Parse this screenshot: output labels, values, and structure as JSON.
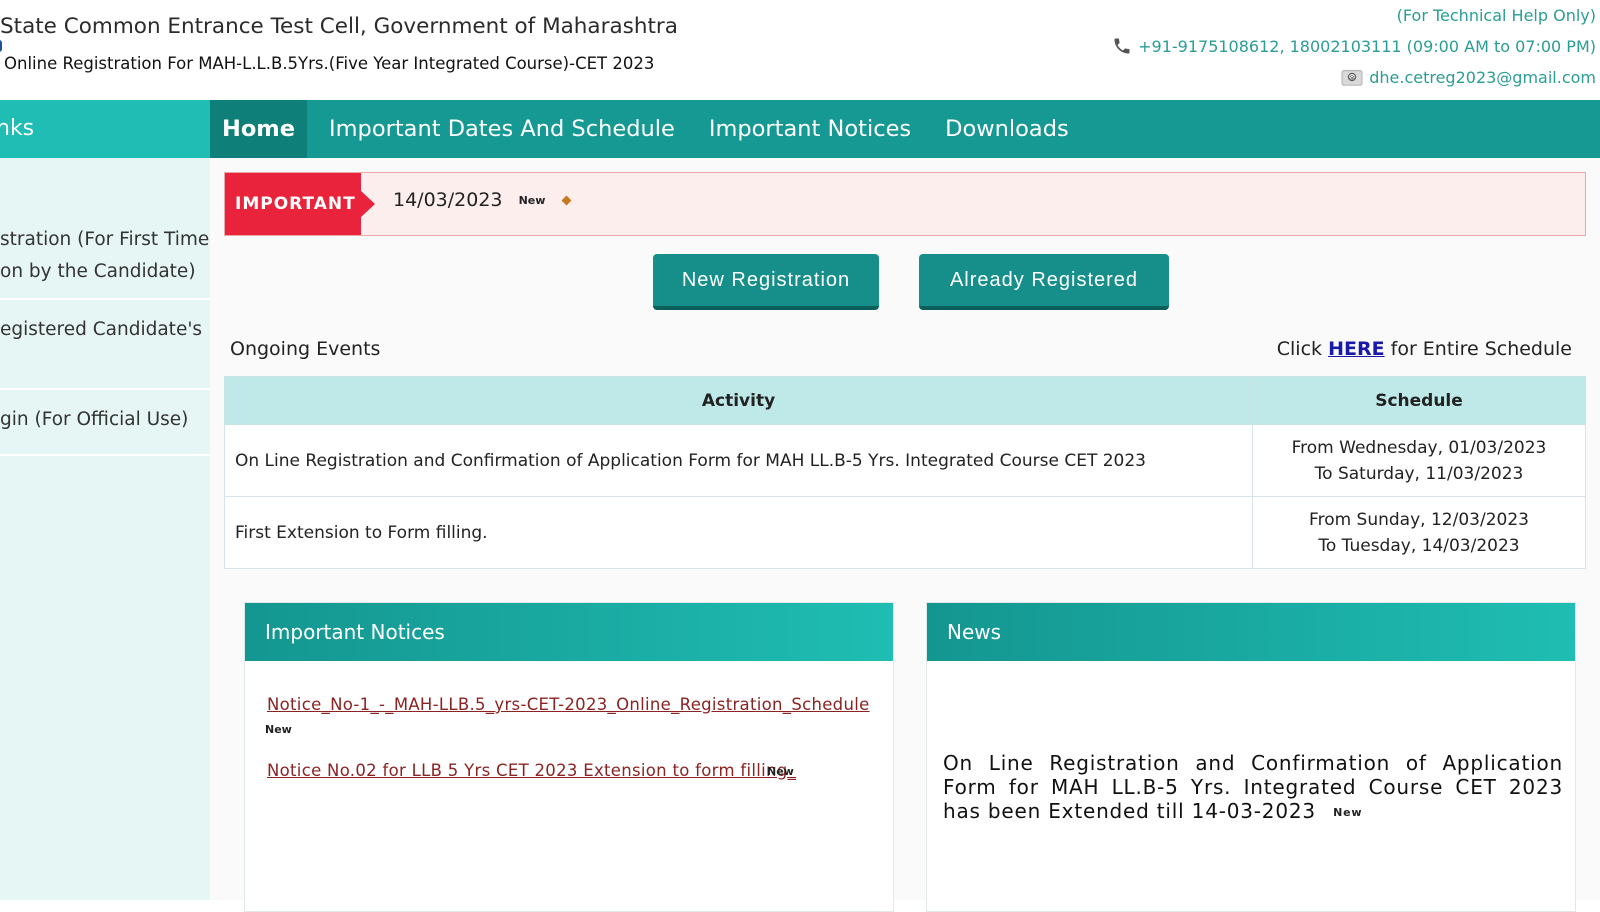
{
  "header": {
    "title": "State Common Entrance Test Cell, Government of Maharashtra",
    "subtitle": "Online Registration For MAH-L.L.B.5Yrs.(Five Year Integrated Course)-CET 2023",
    "help_text": "(For Technical Help Only)",
    "phone": "+91-9175108612, 18002103111 (09:00 AM to 07:00 PM)",
    "email": "dhe.cetreg2023@gmail.com"
  },
  "nav": {
    "left_label": "nks",
    "items": [
      "Home",
      "Important Dates And Schedule",
      "Important Notices",
      "Downloads"
    ]
  },
  "sidebar": {
    "items": [
      {
        "line1": "stration (For First Time",
        "line2": "on by the Candidate)"
      },
      {
        "line1": "egistered Candidate's",
        "line2": ""
      },
      {
        "line1": "gin (For Official Use)",
        "line2": ""
      }
    ]
  },
  "important": {
    "label": "IMPORTANT",
    "date": "14/03/2023",
    "new_tag": "New"
  },
  "buttons": {
    "new_registration": "New Registration",
    "already_registered": "Already Registered"
  },
  "events": {
    "title": "Ongoing Events",
    "schedule_prefix": "Click",
    "schedule_link": "HERE",
    "schedule_suffix": "for Entire Schedule",
    "headers": [
      "Activity",
      "Schedule"
    ],
    "rows": [
      {
        "activity": "On Line Registration and Confirmation of Application Form for MAH LL.B-5 Yrs. Integrated Course CET 2023",
        "from": "From Wednesday, 01/03/2023",
        "to": "To Saturday, 11/03/2023"
      },
      {
        "activity": "First Extension to Form filling.",
        "from": "From Sunday, 12/03/2023",
        "to": "To Tuesday, 14/03/2023"
      }
    ]
  },
  "notices": {
    "title": "Important Notices",
    "items": [
      {
        "text": "Notice_No-1_-_MAH-LLB.5_yrs-CET-2023_Online_Registration_Schedule",
        "new_tag": "New"
      },
      {
        "text": "Notice No.02 for LLB 5 Yrs CET 2023 Extension to form filling_",
        "new_tag": "New"
      }
    ]
  },
  "news": {
    "title": "News",
    "text": "On Line Registration and Confirmation of Application Form for MAH LL.B-5 Yrs. Integrated Course CET 2023 has been Extended till 14-03-2023",
    "new_tag": "New"
  },
  "colors": {
    "nav": "#159992",
    "nav_active": "#0f7f79",
    "accent": "#1fbdb3",
    "important_red": "#e8233b",
    "link_red": "#8b2323"
  },
  "icons": [
    "phone-icon",
    "mail-icon"
  ]
}
